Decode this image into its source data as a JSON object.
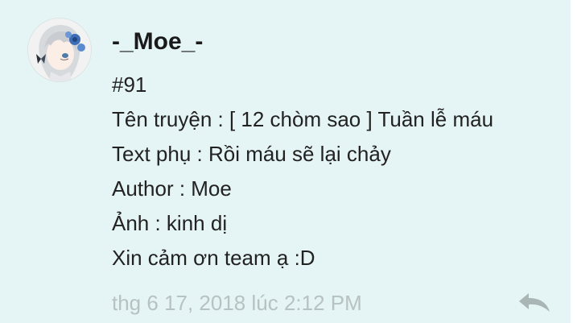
{
  "post": {
    "author": "-_Moe_-",
    "lines": [
      "#91",
      "Tên truyện : [ 12 chòm sao ] Tuần lễ máu",
      "Text phụ : Rồi máu sẽ lại chảy",
      "Author : Moe",
      "Ảnh : kinh dị",
      "Xin cảm ơn team ạ :D"
    ],
    "timestamp": "thg 6 17, 2018 lúc 2:12 PM",
    "avatar_icon": "anime-avatar-icon",
    "reply_icon": "reply-arrow-icon"
  },
  "colors": {
    "post_background": "#e5f4f4",
    "text": "#222222",
    "timestamp": "#b7c2c2",
    "reply_icon": "#aab6b6"
  }
}
